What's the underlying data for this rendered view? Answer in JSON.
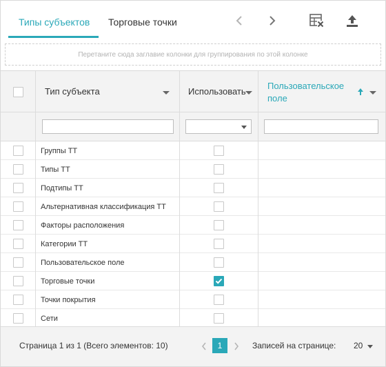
{
  "tabs": [
    {
      "label": "Типы субъектов",
      "active": true
    },
    {
      "label": "Торговые точки",
      "active": false
    }
  ],
  "toolbar": {
    "prev_icon": "chevron-left-icon",
    "next_icon": "chevron-right-icon",
    "excel_icon": "excel-export-icon",
    "upload_icon": "upload-icon"
  },
  "group_panel": {
    "text": "Перетаните сюда заглавие колонки для группирования по этой колонке"
  },
  "columns": {
    "type": "Тип субъекта",
    "use": "Использовать",
    "custom_line1": "Пользовательское",
    "custom_line2": "поле"
  },
  "rows": [
    {
      "label": "Группы ТТ",
      "use": false
    },
    {
      "label": "Типы ТТ",
      "use": false
    },
    {
      "label": "Подтипы ТТ",
      "use": false
    },
    {
      "label": "Альтернативная классификация ТТ",
      "use": false
    },
    {
      "label": "Факторы расположения",
      "use": false
    },
    {
      "label": "Категории ТТ",
      "use": false
    },
    {
      "label": "Пользовательское поле",
      "use": false
    },
    {
      "label": "Торговые точки",
      "use": true
    },
    {
      "label": "Точки покрытия",
      "use": false
    },
    {
      "label": "Сети",
      "use": false
    }
  ],
  "footer": {
    "pager_info": "Страница 1 из 1 (Всего элементов: 10)",
    "current_page": "1",
    "page_size_label": "Записей на странице:",
    "page_size_value": "20"
  },
  "colors": {
    "accent": "#2aa8b8",
    "header_bg": "#f3f3f3"
  }
}
